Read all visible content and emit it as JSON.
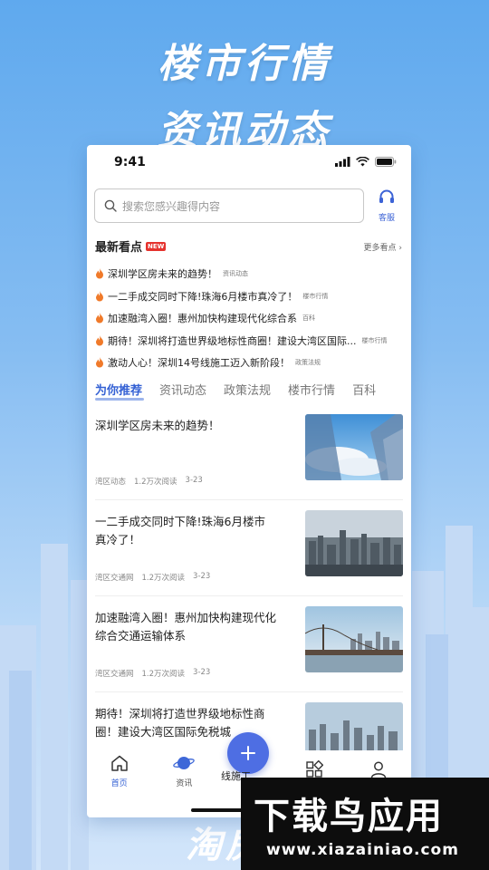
{
  "promo": {
    "headline_1": "楼市行情",
    "headline_2": "资讯动态",
    "bottom_text": "淘房"
  },
  "status_bar": {
    "time": "9:41"
  },
  "search": {
    "placeholder": "搜索您感兴趣得内容",
    "service_label": "客服"
  },
  "hot": {
    "title": "最新看点",
    "badge": "NEW",
    "more": "更多看点",
    "items": [
      {
        "title": "深圳学区房未来的趋势！",
        "category": "资讯动态"
      },
      {
        "title": "一二手成交同时下降!珠海6月楼市真冷了！",
        "category": "楼市行情"
      },
      {
        "title": "加速融湾入圈！惠州加快构建现代化综合系",
        "category": "百科"
      },
      {
        "title": "期待！深圳将打造世界级地标性商圈！建设大湾区国际...",
        "category": "楼市行情"
      },
      {
        "title": "激动人心！深圳14号线施工迈入新阶段！",
        "category": "政策法规"
      }
    ]
  },
  "tabs": [
    "为你推荐",
    "资讯动态",
    "政策法规",
    "楼市行情",
    "百科"
  ],
  "articles": [
    {
      "title": "深圳学区房未来的趋势！",
      "source": "湾区动态",
      "reads": "1.2万次阅读",
      "date": "3-23",
      "image": "skyscraper-sky"
    },
    {
      "title": "一二手成交同时下降!珠海6月楼市真冷了！",
      "source": "湾区交通网",
      "reads": "1.2万次阅读",
      "date": "3-23",
      "image": "city-skyline"
    },
    {
      "title": "加速融湾入圈！惠州加快构建现代化综合交通运输体系",
      "source": "湾区交通网",
      "reads": "1.2万次阅读",
      "date": "3-23",
      "image": "bridge-city"
    },
    {
      "title": "期待！深圳将打造世界级地标性商圈！建设大湾区国际免税城",
      "source": "",
      "reads": "",
      "date": "",
      "image": "city-skyline"
    }
  ],
  "tabbar": {
    "home": "首页",
    "news": "资讯",
    "fab_label": "线施工",
    "apps": "",
    "me": ""
  },
  "watermark": {
    "brand": "下载鸟应用",
    "url": "www.xiazainiao.com"
  },
  "colors": {
    "accent": "#3461d4",
    "fab": "#4e6ee3",
    "hot_icon": "#f07a2a",
    "badge": "#e5322d",
    "background_top": "#5fa9ee"
  }
}
